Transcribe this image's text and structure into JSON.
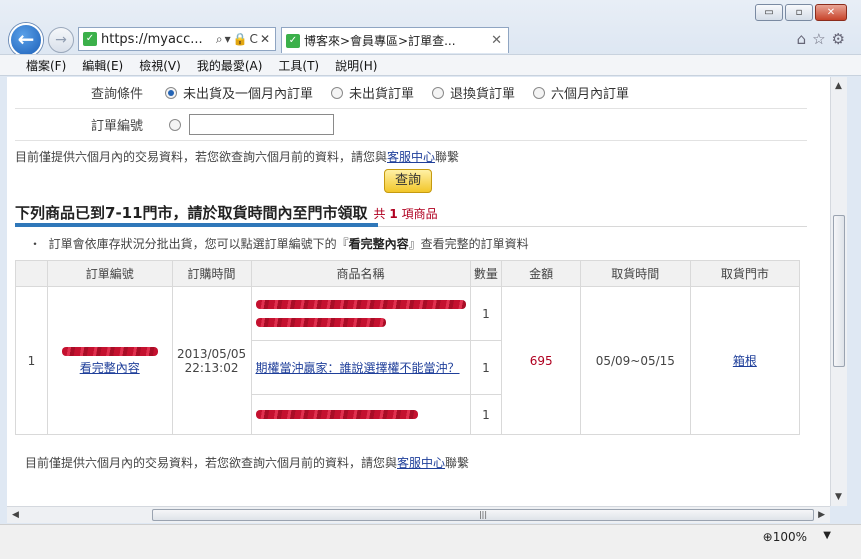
{
  "window": {
    "minimize": "▭",
    "restore": "▫",
    "close": "✕"
  },
  "browser": {
    "back_icon": "back-arrow-icon",
    "address": "https://myacc...",
    "address_icons": "⌕▾🔒C✕",
    "tab_title": "博客來>會員專區>訂單查...",
    "tab_close": "✕",
    "home_icon": "⌂",
    "fav_icon": "☆",
    "settings_icon": "⚙"
  },
  "menu": [
    "檔案(F)",
    "編輯(E)",
    "檢視(V)",
    "我的最愛(A)",
    "工具(T)",
    "說明(H)"
  ],
  "form": {
    "condition_label": "查詢條件",
    "options": [
      "未出貨及一個月內訂單",
      "未出貨訂單",
      "退換貨訂單",
      "六個月內訂單"
    ],
    "selected": "未出貨及一個月內訂單",
    "order_no_label": "訂單編號",
    "order_no_value": ""
  },
  "notice1": {
    "prefix": "目前僅提供六個月內的交易資料，若您欲查詢六個月前的資料，請您與",
    "link": "客服中心",
    "suffix": "聯繫"
  },
  "query_button": "查詢",
  "section": {
    "title": "下列商品已到7-11門市，請於取貨時間內至門市領取",
    "count_prefix": "共",
    "count": "1",
    "count_suffix": "項商品"
  },
  "bullet": {
    "prefix": "訂單會依庫存狀況分批出貨，您可以點選訂單編號下的『",
    "bold": "看完整內容",
    "suffix": "』查看完整的訂單資料"
  },
  "table": {
    "headers": [
      "",
      "訂單編號",
      "訂購時間",
      "商品名稱",
      "數量",
      "金額",
      "取貨時間",
      "取貨門市"
    ],
    "row": {
      "index": "1",
      "order_link": "看完整內容",
      "order_time": "2013/05/05 22:13:02",
      "products": [
        {
          "name": "",
          "qty": "1"
        },
        {
          "name": "期權當沖贏家：誰說選擇權不能當沖？",
          "qty": "1"
        },
        {
          "name": "",
          "qty": "1"
        }
      ],
      "amount": "695",
      "pickup_time": "05/09~05/15",
      "store": "箱根"
    }
  },
  "notice2": {
    "prefix": "目前僅提供六個月內的交易資料，若您欲查詢六個月前的資料，請您與",
    "link": "客服中心",
    "suffix": "聯繫"
  },
  "status": {
    "zoom": "100%",
    "zoom_dropdown": "▼"
  }
}
